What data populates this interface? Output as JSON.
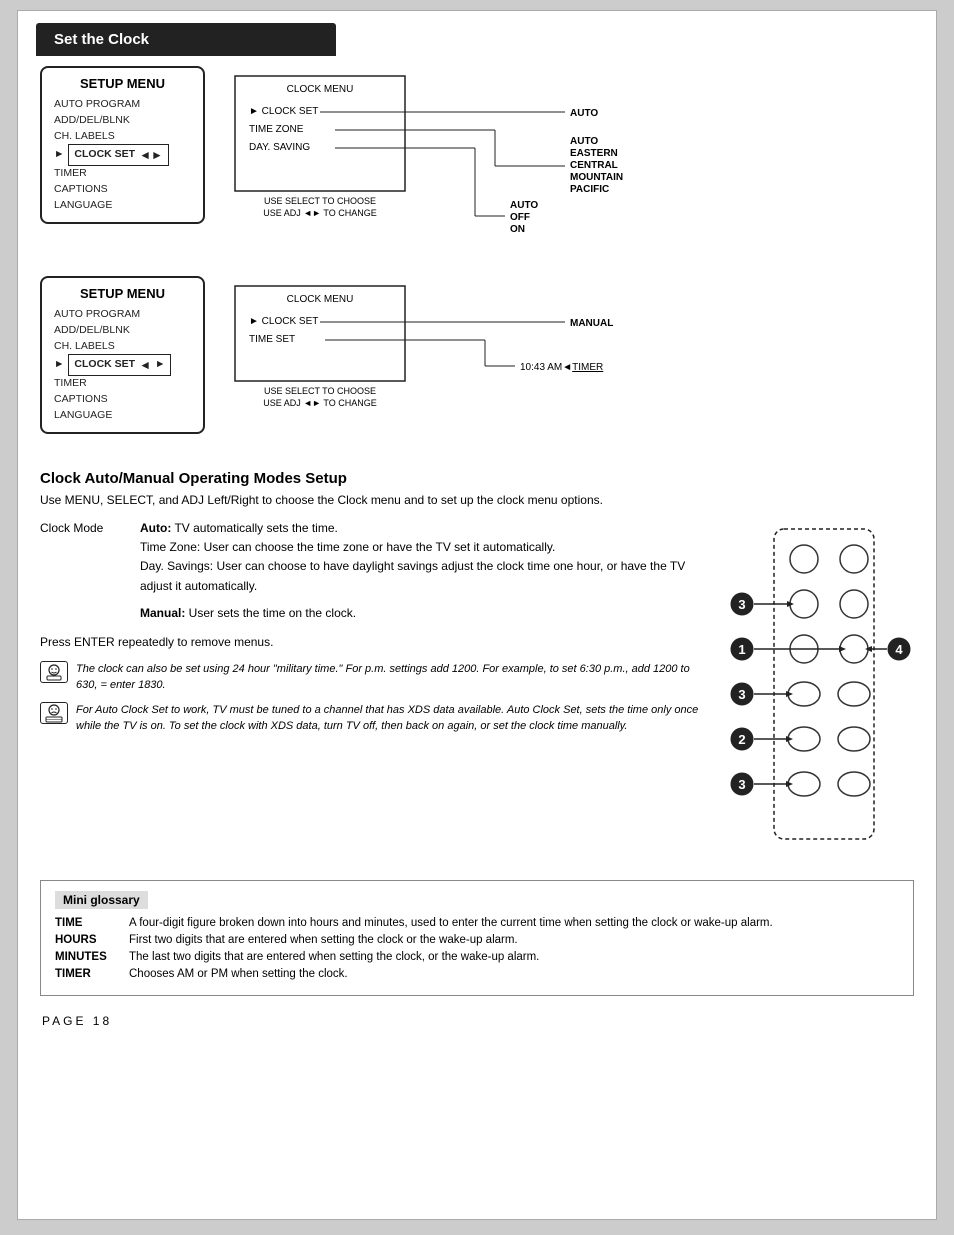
{
  "header": {
    "title": "Set the Clock"
  },
  "diag_top": {
    "setup_menu_title": "SETUP MENU",
    "setup_items": [
      "AUTO PROGRAM",
      "ADD/DEL/BLNK",
      "CH. LABELS",
      "CLOCK SET",
      "TIMER",
      "CAPTIONS",
      "LANGUAGE"
    ],
    "clock_menu_label": "CLOCK MENU",
    "clock_items_top": [
      "CLOCK SET",
      "TIME ZONE",
      "DAY. SAVING"
    ],
    "use_select": "USE SELECT TO CHOOSE",
    "use_adj": "USE ADJ ◄► TO CHANGE",
    "right_label_auto": "AUTO",
    "right_labels_tz": [
      "AUTO",
      "EASTERN",
      "CENTRAL",
      "MOUNTAIN",
      "PACIFIC"
    ],
    "right_labels_ds": [
      "AUTO",
      "OFF",
      "ON"
    ]
  },
  "diag_bottom": {
    "setup_menu_title": "SETUP MENU",
    "setup_items": [
      "AUTO PROGRAM",
      "ADD/DEL/BLNK",
      "CH. LABELS",
      "CLOCK SET",
      "TIMER",
      "CAPTIONS",
      "LANGUAGE"
    ],
    "clock_menu_label": "CLOCK MENU",
    "clock_items": [
      "CLOCK SET",
      "TIME SET"
    ],
    "use_select": "USE SELECT TO CHOOSE",
    "use_adj": "USE ADJ ◄► TO CHANGE",
    "right_label_manual": "MANUAL",
    "right_label_time": "10:43  AM◄TIMER"
  },
  "section": {
    "title": "Clock Auto/Manual Operating Modes Setup",
    "intro": "Use MENU, SELECT, and ADJ Left/Right to choose the Clock menu and to set up the clock menu options.",
    "clock_mode_label": "Clock Mode",
    "auto_bold": "Auto:",
    "auto_desc1": " TV automatically sets the time.",
    "tz_desc": "Time Zone: User can choose the time zone or have the TV set it automatically.",
    "ds_desc": "Day. Savings: User can choose to have daylight savings adjust the clock time one hour, or have the TV adjust it automatically.",
    "manual_bold": "Manual:",
    "manual_desc": " User sets the time on the clock.",
    "press_enter": "Press ENTER repeatedly to remove menus."
  },
  "notes": [
    {
      "text": "The clock can also be set using 24 hour \"military time.\" For p.m. settings add 1200. For example, to set 6:30 p.m., add 1200 to 630, = enter 1830."
    },
    {
      "text": "For Auto Clock Set to work, TV must be tuned to a channel that has XDS data available. Auto Clock Set, sets the time only once while the TV is on. To set the clock with XDS data, turn TV off, then back on again, or set the clock time manually."
    }
  ],
  "glossary": {
    "title": "Mini glossary",
    "items": [
      {
        "term": "TIME",
        "def": "A four-digit figure broken down into hours and minutes, used to enter the current time when setting the clock or wake-up alarm."
      },
      {
        "term": "HOURS",
        "def": "First two digits that are entered when setting the clock or the wake-up alarm."
      },
      {
        "term": "MINUTES",
        "def": "The last two digits that are entered when setting the clock, or the wake-up alarm."
      },
      {
        "term": "TIMER",
        "def": "Chooses AM or PM when setting the clock."
      }
    ]
  },
  "page_number": "PAGE   18",
  "remote_buttons": {
    "label3_top": "3",
    "label1": "1",
    "label3_mid": "3",
    "label2": "2",
    "label3_bot": "3",
    "label4": "4"
  }
}
